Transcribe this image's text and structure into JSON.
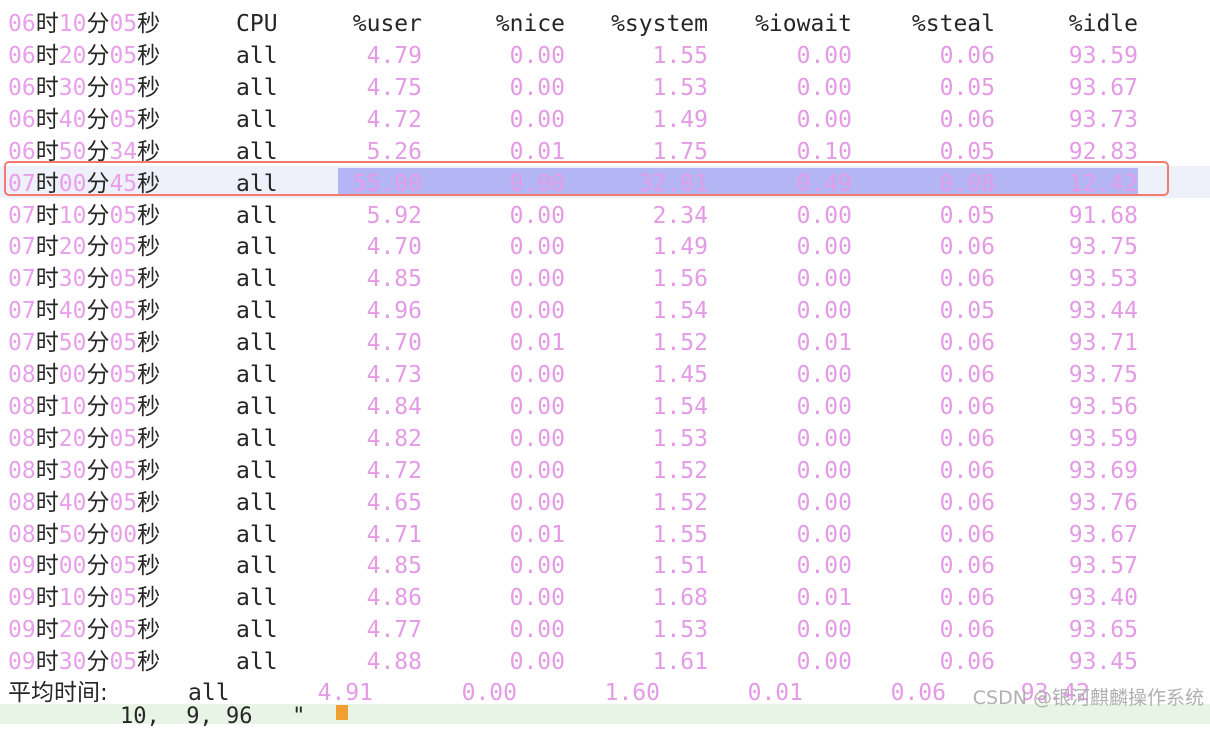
{
  "header": {
    "time": "06时10分05秒",
    "cpu": "CPU",
    "user": "%user",
    "nice": "%nice",
    "system": "%system",
    "iowait": "%iowait",
    "steal": "%steal",
    "idle": "%idle"
  },
  "rows": [
    {
      "time": "06时20分05秒",
      "cpu": "all",
      "user": "4.79",
      "nice": "0.00",
      "system": "1.55",
      "iowait": "0.00",
      "steal": "0.06",
      "idle": "93.59"
    },
    {
      "time": "06时30分05秒",
      "cpu": "all",
      "user": "4.75",
      "nice": "0.00",
      "system": "1.53",
      "iowait": "0.00",
      "steal": "0.05",
      "idle": "93.67"
    },
    {
      "time": "06时40分05秒",
      "cpu": "all",
      "user": "4.72",
      "nice": "0.00",
      "system": "1.49",
      "iowait": "0.00",
      "steal": "0.06",
      "idle": "93.73"
    },
    {
      "time": "06时50分34秒",
      "cpu": "all",
      "user": "5.26",
      "nice": "0.01",
      "system": "1.75",
      "iowait": "0.10",
      "steal": "0.05",
      "idle": "92.83"
    },
    {
      "time": "07时00分45秒",
      "cpu": "all",
      "user": "55.00",
      "nice": "0.00",
      "system": "32.01",
      "iowait": "0.49",
      "steal": "0.08",
      "idle": "12.42"
    },
    {
      "time": "07时10分05秒",
      "cpu": "all",
      "user": "5.92",
      "nice": "0.00",
      "system": "2.34",
      "iowait": "0.00",
      "steal": "0.05",
      "idle": "91.68"
    },
    {
      "time": "07时20分05秒",
      "cpu": "all",
      "user": "4.70",
      "nice": "0.00",
      "system": "1.49",
      "iowait": "0.00",
      "steal": "0.06",
      "idle": "93.75"
    },
    {
      "time": "07时30分05秒",
      "cpu": "all",
      "user": "4.85",
      "nice": "0.00",
      "system": "1.56",
      "iowait": "0.00",
      "steal": "0.06",
      "idle": "93.53"
    },
    {
      "time": "07时40分05秒",
      "cpu": "all",
      "user": "4.96",
      "nice": "0.00",
      "system": "1.54",
      "iowait": "0.00",
      "steal": "0.05",
      "idle": "93.44"
    },
    {
      "time": "07时50分05秒",
      "cpu": "all",
      "user": "4.70",
      "nice": "0.01",
      "system": "1.52",
      "iowait": "0.01",
      "steal": "0.06",
      "idle": "93.71"
    },
    {
      "time": "08时00分05秒",
      "cpu": "all",
      "user": "4.73",
      "nice": "0.00",
      "system": "1.45",
      "iowait": "0.00",
      "steal": "0.06",
      "idle": "93.75"
    },
    {
      "time": "08时10分05秒",
      "cpu": "all",
      "user": "4.84",
      "nice": "0.00",
      "system": "1.54",
      "iowait": "0.00",
      "steal": "0.06",
      "idle": "93.56"
    },
    {
      "time": "08时20分05秒",
      "cpu": "all",
      "user": "4.82",
      "nice": "0.00",
      "system": "1.53",
      "iowait": "0.00",
      "steal": "0.06",
      "idle": "93.59"
    },
    {
      "time": "08时30分05秒",
      "cpu": "all",
      "user": "4.72",
      "nice": "0.00",
      "system": "1.52",
      "iowait": "0.00",
      "steal": "0.06",
      "idle": "93.69"
    },
    {
      "time": "08时40分05秒",
      "cpu": "all",
      "user": "4.65",
      "nice": "0.00",
      "system": "1.52",
      "iowait": "0.00",
      "steal": "0.06",
      "idle": "93.76"
    },
    {
      "time": "08时50分00秒",
      "cpu": "all",
      "user": "4.71",
      "nice": "0.01",
      "system": "1.55",
      "iowait": "0.00",
      "steal": "0.06",
      "idle": "93.67"
    },
    {
      "time": "09时00分05秒",
      "cpu": "all",
      "user": "4.85",
      "nice": "0.00",
      "system": "1.51",
      "iowait": "0.00",
      "steal": "0.06",
      "idle": "93.57"
    },
    {
      "time": "09时10分05秒",
      "cpu": "all",
      "user": "4.86",
      "nice": "0.00",
      "system": "1.68",
      "iowait": "0.01",
      "steal": "0.06",
      "idle": "93.40"
    },
    {
      "time": "09时20分05秒",
      "cpu": "all",
      "user": "4.77",
      "nice": "0.00",
      "system": "1.53",
      "iowait": "0.00",
      "steal": "0.06",
      "idle": "93.65"
    },
    {
      "time": "09时30分05秒",
      "cpu": "all",
      "user": "4.88",
      "nice": "0.00",
      "system": "1.61",
      "iowait": "0.00",
      "steal": "0.06",
      "idle": "93.45"
    }
  ],
  "highlighted_row_index": 4,
  "average": {
    "label": "平均时间:",
    "cpu": "all",
    "user": "4.91",
    "nice": "0.00",
    "system": "1.60",
    "iowait": "0.01",
    "steal": "0.06",
    "idle": "93.42"
  },
  "command_line": "10,  9, 96   \"",
  "watermark": "CSDN @银河麒麟操作系统",
  "colors": {
    "number": "#e49be6",
    "text": "#262626",
    "selection": "#b4b5f5",
    "current_line": "#eef0fa",
    "red_box": "#f27a6e",
    "command_bg": "#e8f5e6",
    "cursor": "#f0a030"
  }
}
